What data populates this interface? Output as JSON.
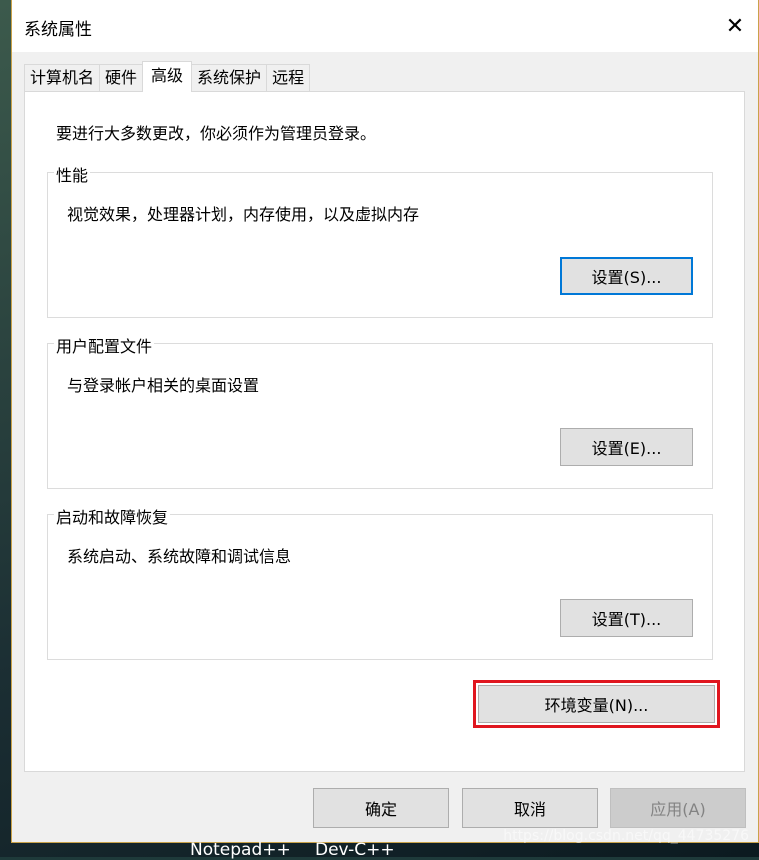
{
  "window": {
    "title": "系统属性"
  },
  "tabs": [
    {
      "label": "计算机名"
    },
    {
      "label": "硬件"
    },
    {
      "label": "高级",
      "active": true
    },
    {
      "label": "系统保护"
    },
    {
      "label": "远程"
    }
  ],
  "advanced": {
    "admin_note": "要进行大多数更改，你必须作为管理员登录。",
    "groups": [
      {
        "title": "性能",
        "description": "视觉效果，处理器计划，内存使用，以及虚拟内存",
        "button": "设置(S)..."
      },
      {
        "title": "用户配置文件",
        "description": "与登录帐户相关的桌面设置",
        "button": "设置(E)..."
      },
      {
        "title": "启动和故障恢复",
        "description": "系统启动、系统故障和调试信息",
        "button": "设置(T)..."
      }
    ],
    "env_button": "环境变量(N)...",
    "highlight_color": "#e0161f"
  },
  "footer": {
    "ok": "确定",
    "cancel": "取消",
    "apply": "应用(A)"
  },
  "taskbar": {
    "items": [
      "Notepad++",
      "Dev-C++"
    ]
  },
  "watermark": "https://blog.csdn.net/qq_44735276"
}
